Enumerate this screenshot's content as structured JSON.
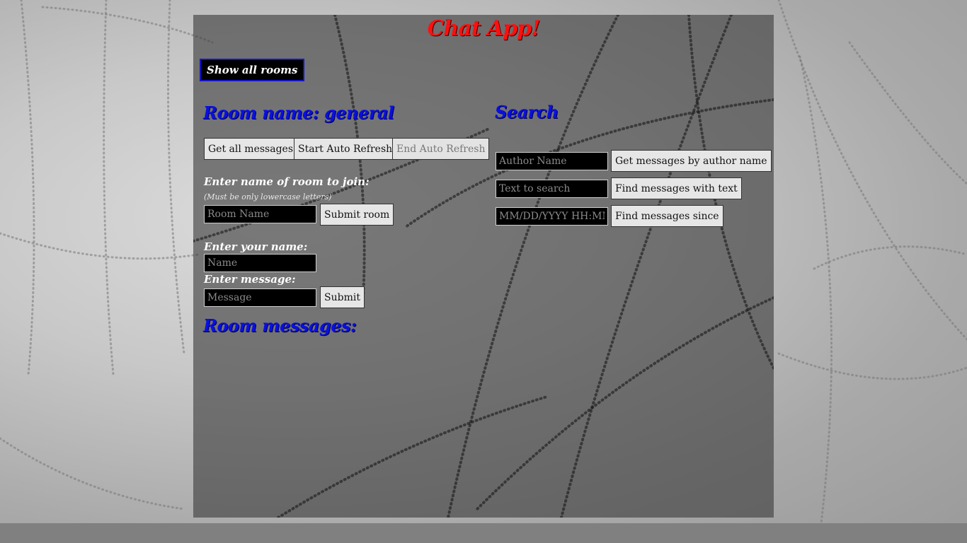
{
  "app": {
    "title": "Chat App!"
  },
  "rooms": {
    "show_all_label": "Show all rooms"
  },
  "room": {
    "heading": "Room name: general",
    "get_all_label": "Get all messages",
    "start_refresh_label": "Start Auto Refresh",
    "end_refresh_label": "End Auto Refresh",
    "join_label": "Enter name of room to join:",
    "join_hint": "(Must be only lowercase letters)",
    "room_placeholder": "Room Name",
    "submit_room_label": "Submit room"
  },
  "compose": {
    "name_label": "Enter your name:",
    "name_placeholder": "Name",
    "message_label": "Enter message:",
    "message_placeholder": "Message",
    "submit_label": "Submit"
  },
  "messages": {
    "heading": "Room messages:"
  },
  "search": {
    "heading": "Search",
    "author_placeholder": "Author Name",
    "author_button": "Get messages by author name",
    "text_placeholder": "Text to search",
    "text_button": "Find messages with text",
    "date_placeholder": "MM/DD/YYYY HH:MM",
    "date_button": "Find messages since"
  },
  "colors": {
    "title": "#ff1010",
    "heading": "#0a10e0",
    "panel": "#3c3c3c"
  }
}
